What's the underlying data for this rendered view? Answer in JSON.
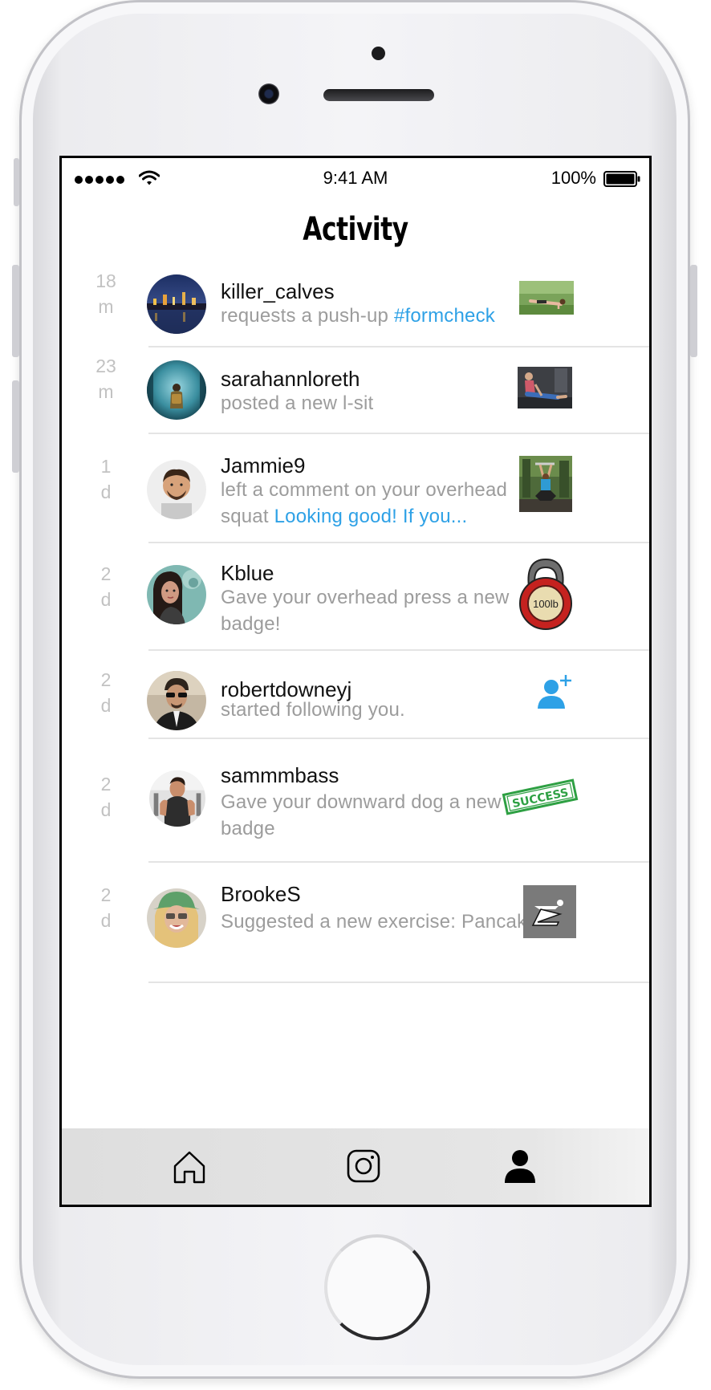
{
  "status_bar": {
    "time": "9:41 AM",
    "battery_percent": "100%",
    "icons": [
      "signal-dots-icon",
      "wifi-icon",
      "battery-icon"
    ]
  },
  "page": {
    "title": "Activity"
  },
  "activity": [
    {
      "time_value": "18",
      "time_unit": "m",
      "username": "killer_calves",
      "action_text": "requests a push-up ",
      "action_highlight": "#formcheck",
      "thumbnail": "push-up-photo"
    },
    {
      "time_value": "23",
      "time_unit": "m",
      "username": "sarahannloreth",
      "action_text": "posted a new l-sit",
      "action_highlight": "",
      "thumbnail": "l-sit-photo"
    },
    {
      "time_value": "1",
      "time_unit": "d",
      "username": "Jammie9",
      "action_text": "left a comment on your overhead squat ",
      "action_highlight": "Looking good! If you...",
      "thumbnail": "overhead-squat-photo"
    },
    {
      "time_value": "2",
      "time_unit": "d",
      "username": "Kblue",
      "action_text": "Gave your overhead press a new badge!",
      "action_highlight": "",
      "thumbnail": "kettlebell-badge",
      "badge_label": "100lb"
    },
    {
      "time_value": "2",
      "time_unit": "d",
      "username": "robertdowneyj",
      "action_text": "started following you.",
      "action_highlight": "",
      "thumbnail": "add-follower-icon"
    },
    {
      "time_value": "2",
      "time_unit": "d",
      "username": "sammmbass",
      "action_text": "Gave your downward dog a new badge",
      "action_highlight": "",
      "thumbnail": "success-stamp",
      "badge_label": "SUCCESS"
    },
    {
      "time_value": "2",
      "time_unit": "d",
      "username": "BrookeS",
      "action_text": "Suggested a new exercise: Pancake",
      "action_highlight": "",
      "thumbnail": "pancake-exercise-icon"
    }
  ],
  "tab_bar": {
    "tabs": [
      {
        "name": "home",
        "icon": "home-icon"
      },
      {
        "name": "camera",
        "icon": "instagram-camera-icon"
      },
      {
        "name": "profile",
        "icon": "profile-icon",
        "active": true
      }
    ]
  },
  "colors": {
    "accent": "#2ea1e6",
    "secondary_text": "#9c9c9c",
    "time_text": "#c2c2c2",
    "tab_bar_bg": "#e2e2e2",
    "badge_red": "#c5221f",
    "success_green": "#2ea043"
  }
}
